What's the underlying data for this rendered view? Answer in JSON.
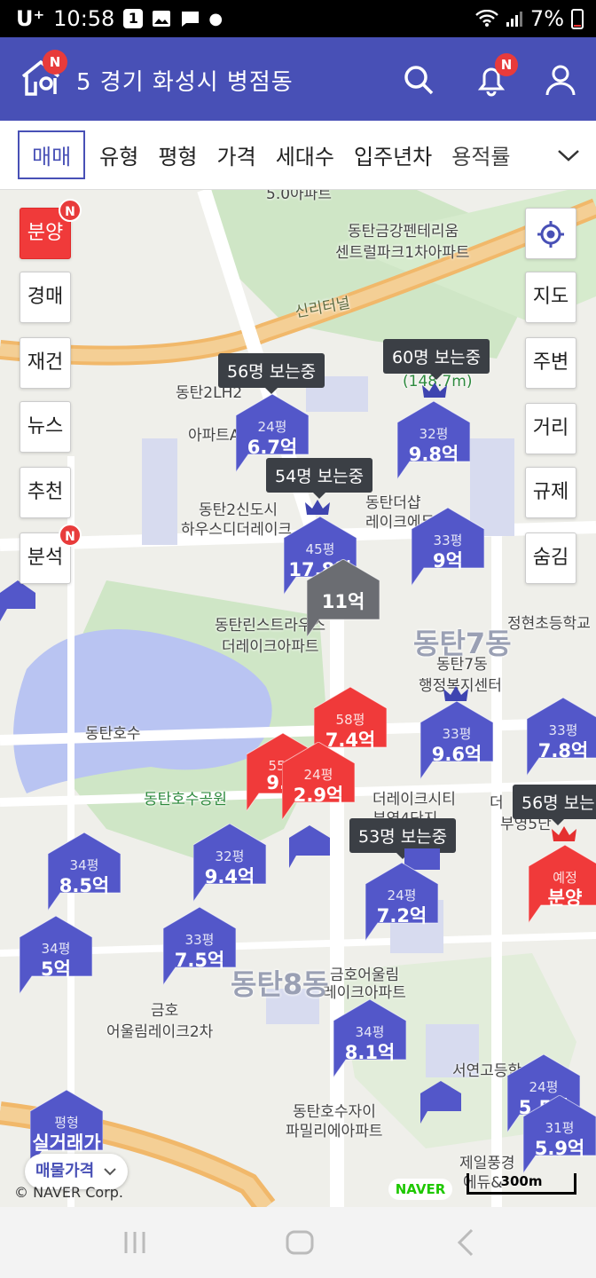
{
  "status_bar": {
    "carrier": "U⁺",
    "time": "10:58",
    "notif_count": "1",
    "battery": "7%"
  },
  "app_bar": {
    "logo_badge": "N",
    "location": "5  경기 화성시 병점동",
    "alarm_badge": "N"
  },
  "filters": {
    "active": "매매",
    "tabs": [
      "유형",
      "평형",
      "가격",
      "세대수",
      "입주년차",
      "용적률"
    ]
  },
  "left_buttons": {
    "bunyang": "분양",
    "bunyang_badge": "N",
    "auction": "경매",
    "rebuild": "재건",
    "news": "뉴스",
    "recommend": "추천",
    "analysis": "분석",
    "analysis_badge": "N"
  },
  "right_buttons": {
    "map": "지도",
    "around": "주변",
    "distance": "거리",
    "regulation": "규제",
    "hide": "숨김"
  },
  "viewers": {
    "v1": "56명 보는중",
    "v2": "60명 보는중",
    "v3": "54명 보는중",
    "v4": "53명 보는중",
    "v5": "56명 보는"
  },
  "markers": [
    {
      "size": "24평",
      "price": "6.7억"
    },
    {
      "size": "32평",
      "price": "9.8억"
    },
    {
      "size": "45평",
      "price": "17.8억"
    },
    {
      "size": "33평",
      "price": "9억"
    },
    {
      "size": "",
      "price": "11억"
    },
    {
      "size": "58평",
      "price": "7.4억"
    },
    {
      "size": "33평",
      "price": "9.6억"
    },
    {
      "size": "33평",
      "price": "7.8억"
    },
    {
      "size": "55평",
      "price": "9.5"
    },
    {
      "size": "24평",
      "price": "2.9억"
    },
    {
      "size": "34평",
      "price": "8.5억"
    },
    {
      "size": "32평",
      "price": "9.4억"
    },
    {
      "size": "24평",
      "price": "7.2억"
    },
    {
      "size": "예정",
      "price": "분양"
    },
    {
      "size": "34평",
      "price": "5억"
    },
    {
      "size": "33평",
      "price": "7.5억"
    },
    {
      "size": "34평",
      "price": "8.1억"
    },
    {
      "size": "24평",
      "price": "5.5억"
    },
    {
      "size": "31평",
      "price": "5.9억"
    },
    {
      "size": "평형",
      "price": "실거래가"
    }
  ],
  "map_labels": {
    "l1": "동탄금강펜테리움",
    "l2": "센트럴파크1차아파트",
    "l3": "신리터널",
    "l4": "(148.7m)",
    "l5": "동탄2LH2",
    "l6": "아파트A",
    "l7": "동탄2신도시",
    "l8": "하우스디더레이크",
    "l9": "동탄더샵",
    "l10": "레이크에듀타",
    "l11": "동탄린스트라우스",
    "l12": "더레이크아파트",
    "l13": "동탄7동",
    "l14": "동탄7동",
    "l15": "행정복지센터",
    "l16": "정현초등학교",
    "l17": "동탄호수",
    "l18": "동탄호수공원",
    "l19": "더레이크시티",
    "l20": "부영4단지",
    "l21": "더",
    "l22": "부영5단",
    "l23": "금호어울림",
    "l24": "레이크아파트",
    "l25": "동탄8동",
    "l26": "금호",
    "l27": "어울림레이크2차",
    "l28": "서연고등학",
    "l29": "동탄호수자이",
    "l30": "파밀리에아파트",
    "l31": "제일풍경",
    "l32": "에듀&",
    "l33": "5.0아파트"
  },
  "footer": {
    "price_toggle": "매물가격",
    "copyright": "© NAVER Corp.",
    "naver": "NAVER",
    "scale": "300m"
  },
  "colors": {
    "brand": "#4850b6",
    "marker_blue": "#5357c9",
    "marker_red": "#f03a3a",
    "marker_gray": "#6b6d72"
  }
}
